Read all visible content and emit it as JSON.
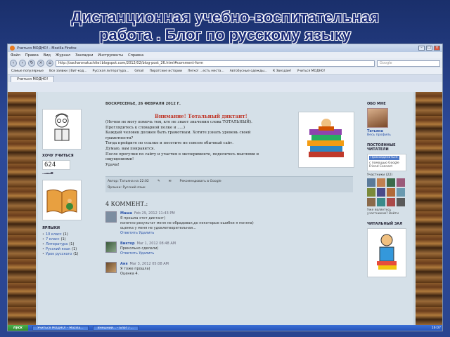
{
  "slide": {
    "title_line1": "Дистанционная учебно-воспитательная",
    "title_line2": "работа . Блог по русскому языку"
  },
  "browser": {
    "window_title": "Учиться МОДНО! - Mozilla Firefox",
    "menu": [
      "Файл",
      "Правка",
      "Вид",
      "Журнал",
      "Закладки",
      "Инструменты",
      "Справка"
    ],
    "url": "http://zacharovatuchitel.blogspot.com/2012/02/blog-post_26.html#comment-form",
    "search_placeholder": "Google",
    "bookmarks": [
      "Самые популярные",
      "Все заявки | Вит-код...",
      "Русская литература...",
      "Gmail",
      "Пиратские истории",
      "Легко! ...есть места...",
      "Автобусные одежды...",
      "К Звездам!",
      "Учиться МОДНО!"
    ],
    "tab_label": "Учиться МОДНО!"
  },
  "blog": {
    "sidebar": {
      "counter_heading": "ХОЧУ УЧИТЬСЯ",
      "counter_value": "624",
      "labels_heading": "ЯРЛЫКИ",
      "labels": [
        {
          "name": "10 класс",
          "count": "(1)"
        },
        {
          "name": "7 класс",
          "count": "(1)"
        },
        {
          "name": "Литература",
          "count": "(1)"
        },
        {
          "name": "Русский язык",
          "count": "(1)"
        },
        {
          "name": "Урок русского",
          "count": "(1)"
        }
      ]
    },
    "post": {
      "date": "ВОСКРЕСЕНЬЕ, 26 ФЕВРАЛЯ 2012 Г.",
      "heading": "Внимание! Тотальный диктант!",
      "lines": [
        "(Нечем не могу помочь тем, кто не знает значения слова ТОТАЛЬНЫЙ).",
        "Проглядитесь к словарной полке и .....)",
        "Каждый человек должен быть грамотным. Хотите узнать уровень своей",
        "грамотности?",
        "Тогда пройдите по ссылке и посетите не совсем обычный сайт.",
        " Думаю, вам понравится.",
        "После прогулки по сайту и участия в эксперименте, поделитесь мыслями и",
        "ощущениями!",
        " Удачи!"
      ],
      "author_text": "Автор: Татьяна на 22:02",
      "labels_text": "Ярлыки: Русский язык",
      "recommend_text": "Рекомендовать в Google"
    },
    "comments_heading": "4 КОММЕНТ.:",
    "comments": [
      {
        "author": "Маша",
        "date": "Feb 29, 2012 11:43 PM",
        "text": [
          "Я прошла этот диктант)",
          "конечно результат меня не обрадовал,до некоторые ошибки я поняла)",
          "оценка у меня не удовлетворительная..."
        ],
        "actions": "Ответить  Удалить"
      },
      {
        "author": "Виктор",
        "date": "Mar 1, 2012 08:48 AM",
        "text": [
          "Прикольно сделали)"
        ],
        "actions": "Ответить  Удалить"
      },
      {
        "author": "Аня",
        "date": "Mar 3, 2012 05:08 AM",
        "text": [
          "Я тоже прошла)",
          "Оценка 4."
        ],
        "actions": ""
      }
    ],
    "rightbar": {
      "about_heading": "ОБО МНЕ",
      "name": "Татьяна",
      "profile_link": "Весь профиль",
      "followers_heading": "ПОСТОЯННЫЕ ЧИТАТЕЛИ",
      "join_label": "Присоединиться",
      "join_text": "с помощью Google Friend Connect",
      "members_label": "Участники (22)",
      "already_member": "Уже являетесь участником? Войти",
      "reading_heading": "ЧИТАЛЬНЫЙ ЗАЛ"
    }
  },
  "taskbar": {
    "start_label": "пуск",
    "items": [
      "Учиться МОДНО! - Mozilla...",
      "Внешний... - Блог / ..."
    ],
    "clock": "16:07"
  }
}
